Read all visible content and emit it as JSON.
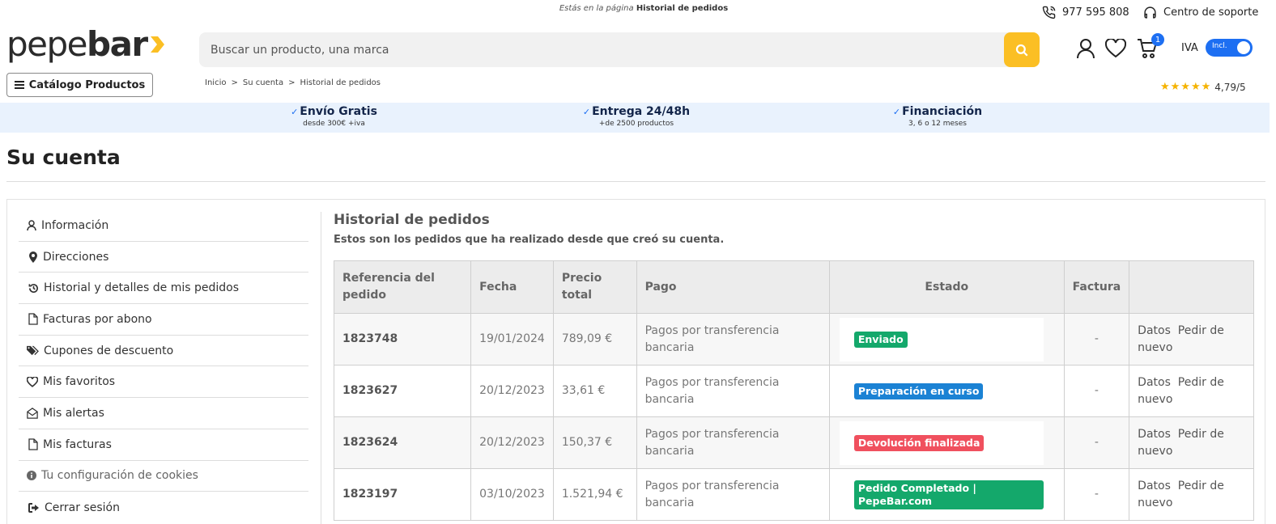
{
  "header": {
    "page_indicator_prefix": "Estás en la página",
    "page_indicator_name": "Historial de pedidos",
    "phone": "977 595 808",
    "support": "Centro de soporte",
    "logo_part1": "pepe",
    "logo_part2": "bar",
    "search_placeholder": "Buscar un producto, una marca",
    "cart_count": "1",
    "iva_label": "IVA",
    "iva_toggle_text": "Incl.",
    "catalog_button": "Catálogo Productos",
    "rating_stars": "★★★★★",
    "rating": "4,79/5"
  },
  "breadcrumb": {
    "items": [
      "Inicio",
      "Su cuenta",
      "Historial de pedidos"
    ],
    "separator": ">"
  },
  "benefits": [
    {
      "title": "Envío Gratis",
      "subtitle": "desde 300€ +iva"
    },
    {
      "title": "Entrega 24/48h",
      "subtitle": "+de 2500 productos"
    },
    {
      "title": "Financiación",
      "subtitle": "3, 6 o 12 meses"
    }
  ],
  "page_title": "Su cuenta",
  "sidebar": {
    "items": [
      {
        "label": "Información",
        "icon": "user-icon"
      },
      {
        "label": "Direcciones",
        "icon": "map-pin-icon"
      },
      {
        "label": "Historial y detalles de mis pedidos",
        "icon": "history-icon"
      },
      {
        "label": "Facturas por abono",
        "icon": "document-icon"
      },
      {
        "label": "Cupones de descuento",
        "icon": "tags-icon"
      },
      {
        "label": "Mis favoritos",
        "icon": "heart-icon"
      },
      {
        "label": "Mis alertas",
        "icon": "envelope-open-icon"
      },
      {
        "label": "Mis facturas",
        "icon": "document-icon"
      },
      {
        "label": "Tu configuración de cookies",
        "icon": "info-icon"
      },
      {
        "label": "Cerrar sesión",
        "icon": "logout-icon"
      }
    ]
  },
  "history": {
    "title": "Historial de pedidos",
    "subtitle": "Estos son los pedidos que ha realizado desde que creó su cuenta.",
    "columns": [
      "Referencia del pedido",
      "Fecha",
      "Precio total",
      "Pago",
      "Estado",
      "Factura",
      ""
    ],
    "rows": [
      {
        "ref": "1823748",
        "date": "19/01/2024",
        "total": "789,09 €",
        "payment": "Pagos por transferencia bancaria",
        "status": "Enviado",
        "status_color": "#14a86b",
        "invoice": "-",
        "details": "Datos",
        "reorder": "Pedir de nuevo"
      },
      {
        "ref": "1823627",
        "date": "20/12/2023",
        "total": "33,61 €",
        "payment": "Pagos por transferencia bancaria",
        "status": "Preparación en curso",
        "status_color": "#1b82d4",
        "invoice": "-",
        "details": "Datos",
        "reorder": "Pedir de nuevo"
      },
      {
        "ref": "1823624",
        "date": "20/12/2023",
        "total": "150,37 €",
        "payment": "Pagos por transferencia bancaria",
        "status": "Devolución finalizada",
        "status_color": "#f0505e",
        "invoice": "-",
        "details": "Datos",
        "reorder": "Pedir de nuevo"
      },
      {
        "ref": "1823197",
        "date": "03/10/2023",
        "total": "1.521,94 €",
        "payment": "Pagos por transferencia bancaria",
        "status": "Pedido Completado | PepeBar.com",
        "status_color": "#14a86b",
        "invoice": "-",
        "details": "Datos",
        "reorder": "Pedir de nuevo"
      }
    ]
  },
  "colors": {
    "accent_yellow": "#fbbf24",
    "accent_blue": "#1d6ff2",
    "benefit_band": "#e9f2fd"
  }
}
